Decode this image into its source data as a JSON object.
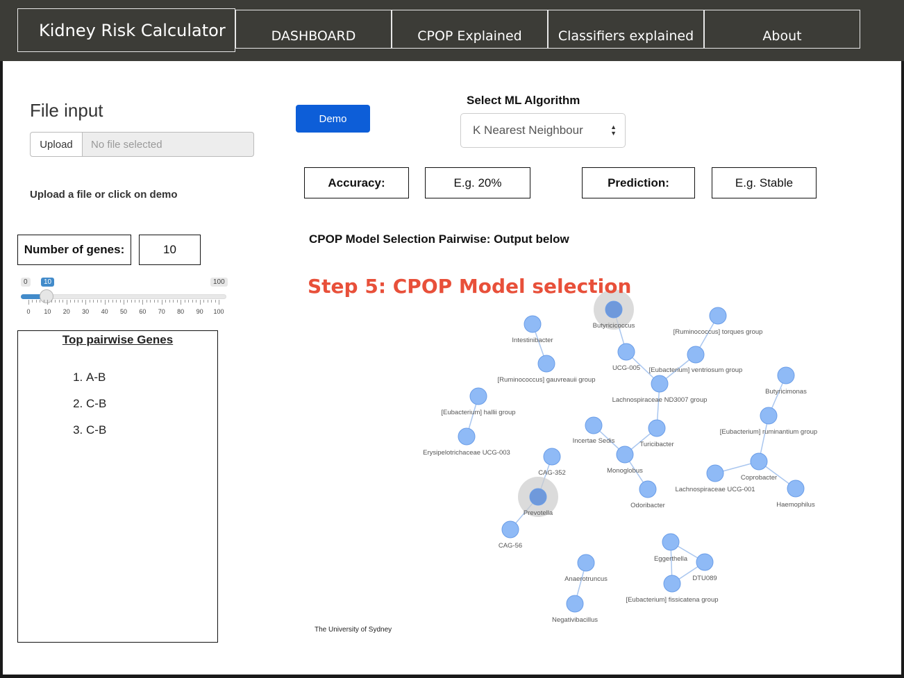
{
  "nav": {
    "brand": "Kidney Risk Calculator",
    "items": [
      "DASHBOARD",
      "CPOP Explained",
      "Classifiers explained",
      "About"
    ]
  },
  "file_input": {
    "title": "File input",
    "upload_label": "Upload",
    "placeholder": "No file selected",
    "hint": "Upload a file or click on demo"
  },
  "genes": {
    "label": "Number of genes:",
    "value": "10",
    "slider": {
      "min": 0,
      "max": 100,
      "value": 10,
      "labels": [
        "0",
        "10",
        "20",
        "30",
        "40",
        "50",
        "60",
        "70",
        "80",
        "90",
        "100"
      ],
      "min_label": "0",
      "max_label": "100",
      "value_label": "10"
    }
  },
  "pairwise": {
    "title": "Top pairwise Genes",
    "items": [
      "A-B",
      "C-B",
      "C-B"
    ]
  },
  "demo_button": "Demo",
  "algorithm": {
    "label": "Select ML Algorithm",
    "selected": "K Nearest Neighbour"
  },
  "results": {
    "accuracy_label": "Accuracy:",
    "accuracy_value": "E.g. 20%",
    "prediction_label": "Prediction:",
    "prediction_value": "E.g. Stable"
  },
  "output_title": "CPOP Model Selection Pairwise: Output below",
  "graph": {
    "step_title": "Step 5: CPOP Model selection",
    "footer": "The University of Sydney",
    "colors": {
      "node": "#8fbaf6",
      "node_stroke": "#6a9de8",
      "highlight_node": "#6f99db",
      "halo": "#cccccc",
      "edge": "#a9c6ef",
      "title": "#e8503a"
    },
    "nodes": [
      "Butyricicoccus",
      "Intestinibacter",
      "[Ruminococcus] torques group",
      "UCG-005",
      "[Ruminococcus] gauvreauii group",
      "[Eubacterium] ventriosum group",
      "Lachnospiraceae ND3007 group",
      "Butyricimonas",
      "[Eubacterium] hallii group",
      "[Eubacterium] ruminantium group",
      "Incertae Sedis",
      "Turicibacter",
      "Erysipelotrichaceae UCG-003",
      "CAG-352",
      "Monoglobus",
      "Coprobacter",
      "Lachnospiraceae UCG-001",
      "Haemophilus",
      "Odoribacter",
      "Prevotella",
      "CAG-56",
      "Eggerthella",
      "DTU089",
      "Anaerotruncus",
      "[Eubacterium] fissicatena group",
      "Negativibacillus"
    ]
  }
}
